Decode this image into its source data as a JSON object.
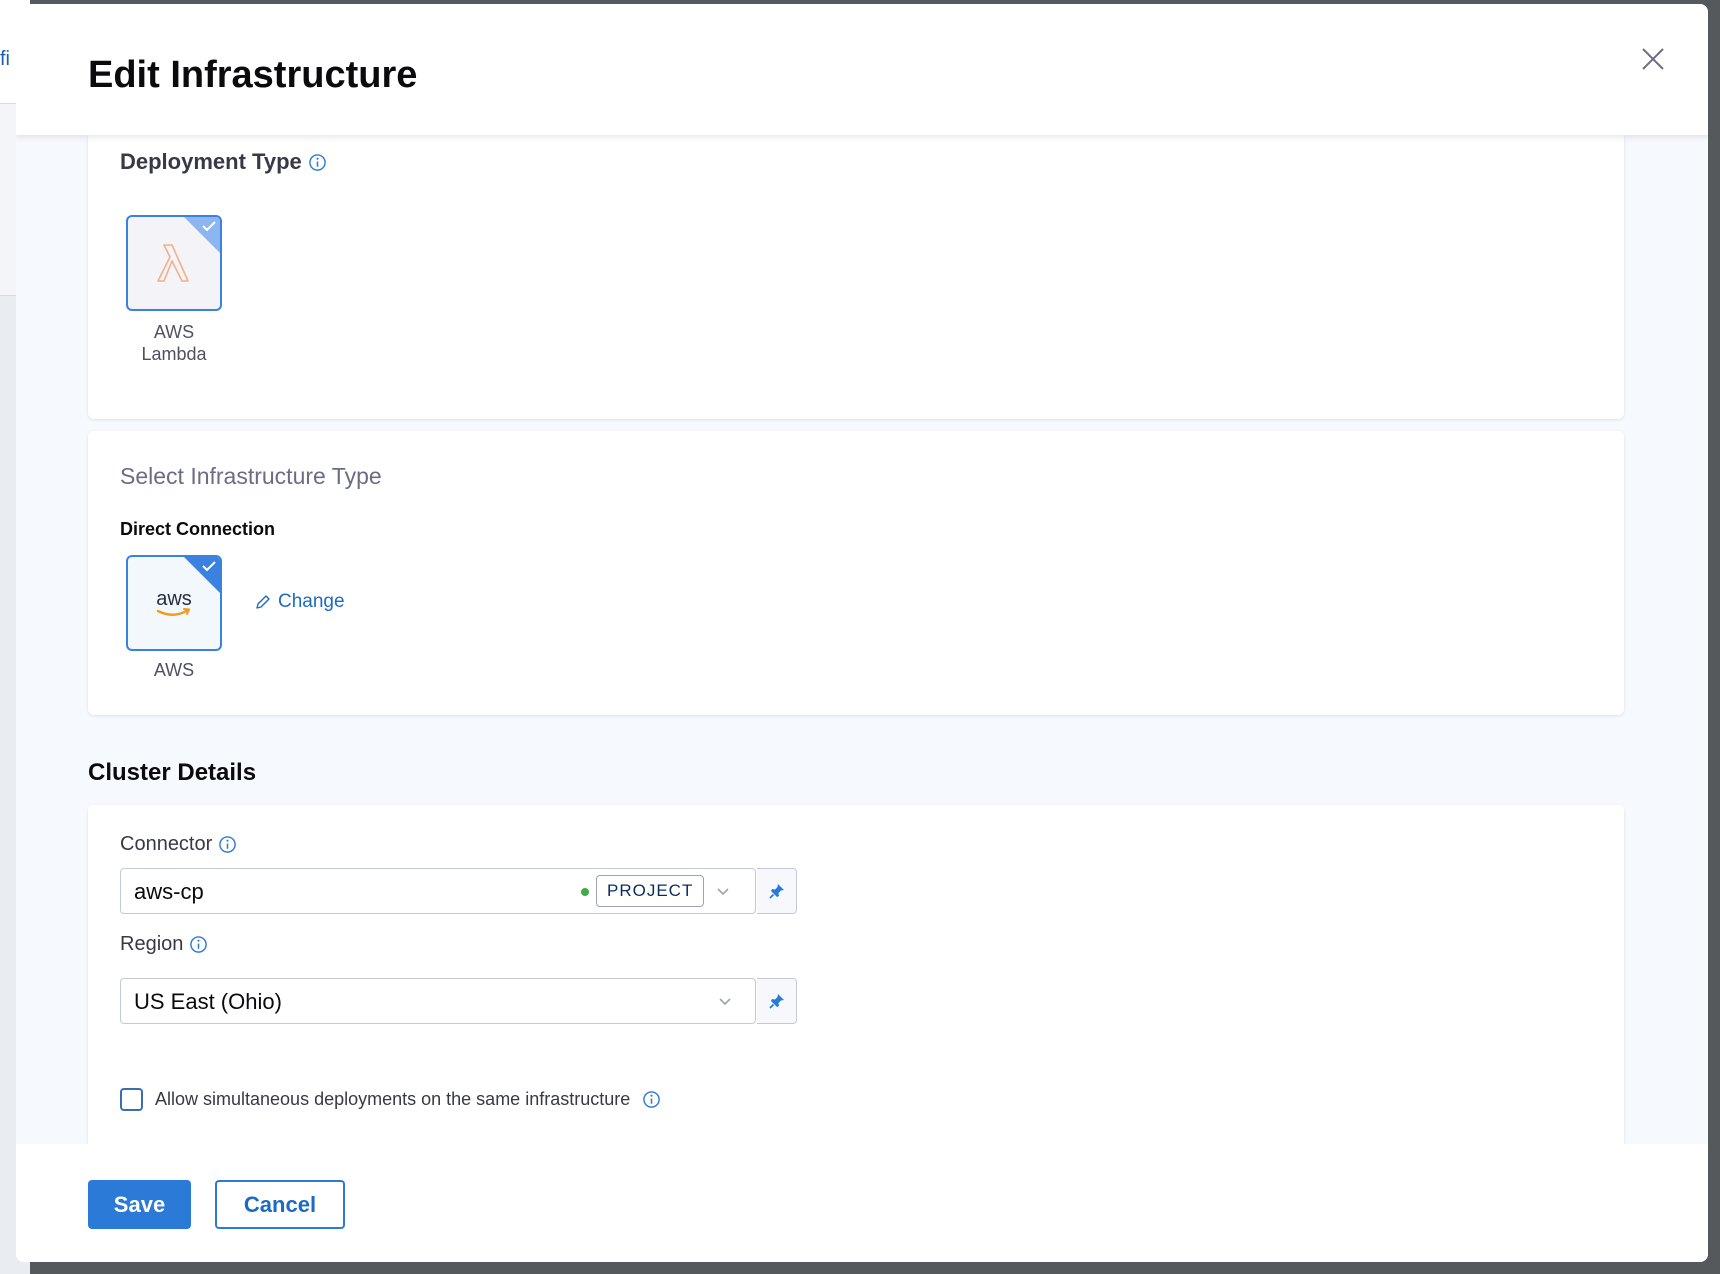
{
  "background": {
    "partial_text": "fi"
  },
  "dialog": {
    "title": "Edit Infrastructure",
    "close_icon": "close-icon"
  },
  "deployment_type": {
    "label": "Deployment Type",
    "tile": {
      "icon": "aws-lambda-icon",
      "label_line1": "AWS",
      "label_line2": "Lambda",
      "selected": true
    }
  },
  "infrastructure_type": {
    "heading": "Select Infrastructure Type",
    "group_label": "Direct Connection",
    "tile": {
      "icon": "aws-logo-icon",
      "logo_text": "aws",
      "label": "AWS",
      "selected": true
    },
    "change_label": "Change"
  },
  "cluster_details": {
    "title": "Cluster Details",
    "connector": {
      "label": "Connector",
      "value": "aws-cp",
      "scope_badge": "PROJECT",
      "status_color": "#42ab45"
    },
    "region": {
      "label": "Region",
      "value": "US East (Ohio)"
    },
    "simultaneous": {
      "label": "Allow simultaneous deployments on the same infrastructure",
      "checked": false
    }
  },
  "footer": {
    "save_label": "Save",
    "cancel_label": "Cancel"
  },
  "colors": {
    "primary": "#2b7ad8",
    "link": "#1b6bc6",
    "tile_border": "#3b82e0"
  }
}
